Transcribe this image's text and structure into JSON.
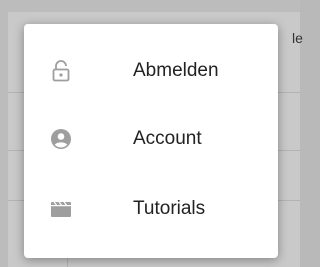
{
  "background": {
    "partial_text": "le"
  },
  "menu": {
    "items": [
      {
        "label": "Abmelden",
        "icon": "lock-open-icon"
      },
      {
        "label": "Account",
        "icon": "account-circle-icon"
      },
      {
        "label": "Tutorials",
        "icon": "movie-clapper-icon"
      }
    ]
  },
  "colors": {
    "icon": "#9e9e9e",
    "text": "#222222",
    "menu_bg": "#ffffff"
  }
}
